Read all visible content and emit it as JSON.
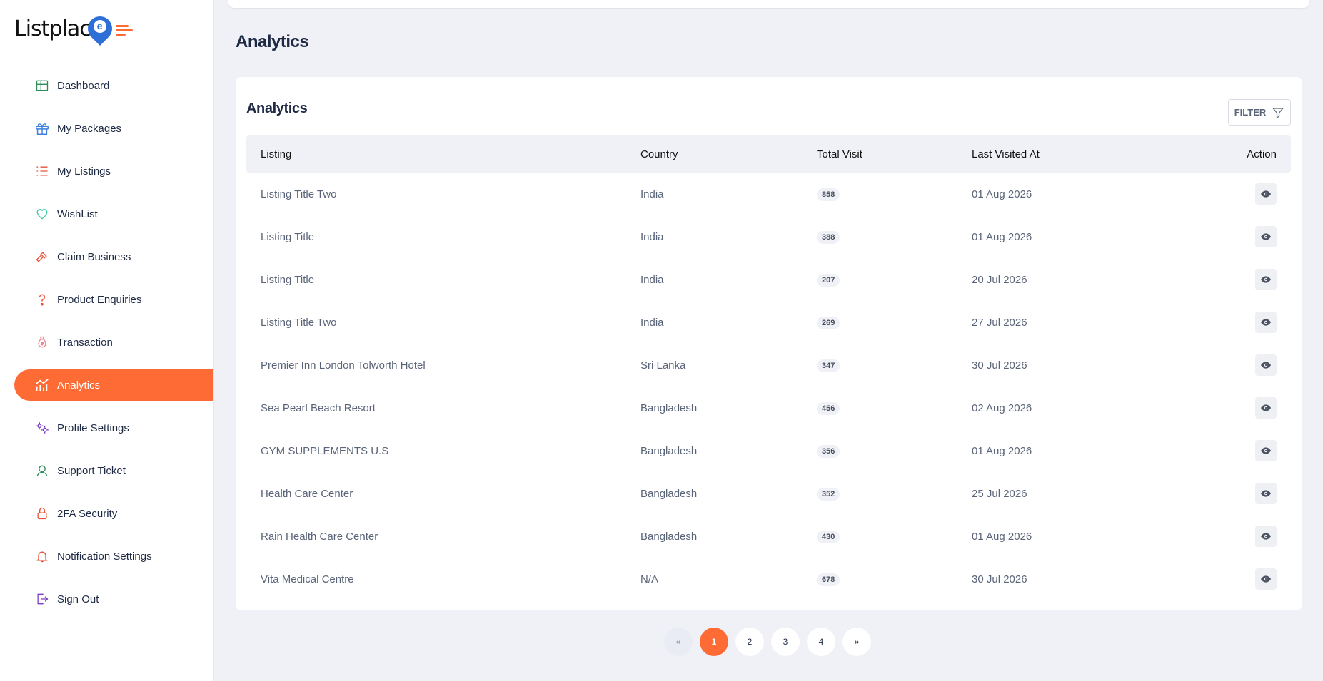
{
  "brand": {
    "name": "Listplac",
    "mark": "e"
  },
  "sidebar": {
    "items": [
      {
        "label": "Dashboard",
        "icon": "grid-icon",
        "color": "#2e8b57",
        "active": false
      },
      {
        "label": "My Packages",
        "icon": "gift-icon",
        "color": "#3f7fe0",
        "active": false
      },
      {
        "label": "My Listings",
        "icon": "list-icon",
        "color": "#e8503a",
        "active": false
      },
      {
        "label": "WishList",
        "icon": "heart-icon",
        "color": "#3cc9a8",
        "active": false
      },
      {
        "label": "Claim Business",
        "icon": "hammer-icon",
        "color": "#e8503a",
        "active": false
      },
      {
        "label": "Product Enquiries",
        "icon": "question-icon",
        "color": "#e8503a",
        "active": false
      },
      {
        "label": "Transaction",
        "icon": "money-bag-icon",
        "color": "#f08090",
        "active": false
      },
      {
        "label": "Analytics",
        "icon": "chart-icon",
        "color": "#ffffff",
        "active": true
      },
      {
        "label": "Profile Settings",
        "icon": "gears-icon",
        "color": "#7b3fc4",
        "active": false
      },
      {
        "label": "Support Ticket",
        "icon": "support-icon",
        "color": "#2e8b57",
        "active": false
      },
      {
        "label": "2FA Security",
        "icon": "lock-icon",
        "color": "#e8503a",
        "active": false
      },
      {
        "label": "Notification Settings",
        "icon": "bell-icon",
        "color": "#e8503a",
        "active": false
      },
      {
        "label": "Sign Out",
        "icon": "sign-out-icon",
        "color": "#7b3fc4",
        "active": false
      }
    ]
  },
  "page": {
    "title": "Analytics"
  },
  "card": {
    "title": "Analytics",
    "filter_label": "FILTER"
  },
  "table": {
    "headers": [
      "Listing",
      "Country",
      "Total Visit",
      "Last Visited At",
      "Action"
    ],
    "rows": [
      {
        "listing": "Listing Title Two",
        "country": "India",
        "visits": "858",
        "last": "01 Aug 2026"
      },
      {
        "listing": "Listing Title",
        "country": "India",
        "visits": "388",
        "last": "01 Aug 2026"
      },
      {
        "listing": "Listing Title",
        "country": "India",
        "visits": "207",
        "last": "20 Jul 2026"
      },
      {
        "listing": "Listing Title Two",
        "country": "India",
        "visits": "269",
        "last": "27 Jul 2026"
      },
      {
        "listing": "Premier Inn London Tolworth Hotel",
        "country": "Sri Lanka",
        "visits": "347",
        "last": "30 Jul 2026"
      },
      {
        "listing": "Sea Pearl Beach Resort",
        "country": "Bangladesh",
        "visits": "456",
        "last": "02 Aug 2026"
      },
      {
        "listing": "GYM SUPPLEMENTS U.S",
        "country": "Bangladesh",
        "visits": "356",
        "last": "01 Aug 2026"
      },
      {
        "listing": "Health Care Center",
        "country": "Bangladesh",
        "visits": "352",
        "last": "25 Jul 2026"
      },
      {
        "listing": "Rain Health Care Center",
        "country": "Bangladesh",
        "visits": "430",
        "last": "01 Aug 2026"
      },
      {
        "listing": "Vita Medical Centre",
        "country": "N/A",
        "visits": "678",
        "last": "30 Jul 2026"
      }
    ]
  },
  "pagination": {
    "prev": "«",
    "next": "»",
    "pages": [
      "1",
      "2",
      "3",
      "4"
    ],
    "current": "1"
  },
  "colors": {
    "accent": "#ff6b35",
    "brand_blue": "#2d6fd6",
    "text": "#1e2a44"
  }
}
